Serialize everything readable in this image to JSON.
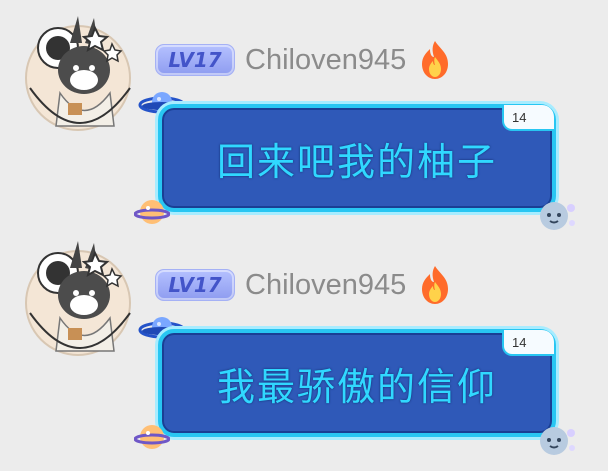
{
  "messages": [
    {
      "level": "LV17",
      "username": "Chiloven945",
      "text": "回来吧我的柚子",
      "badge": "14"
    },
    {
      "level": "LV17",
      "username": "Chiloven945",
      "text": "我最骄傲的信仰",
      "badge": "14"
    }
  ],
  "colors": {
    "background": "#ececec",
    "bubble_fill": "#2f59b8",
    "bubble_border": "#28c6f2",
    "bubble_text": "#30d8ff",
    "level_badge": "#8e9cf0",
    "username": "#8b8b8b"
  },
  "icons": [
    "avatar-image",
    "flame-icon",
    "saturn-icon",
    "planet-icon",
    "moon-icon"
  ]
}
